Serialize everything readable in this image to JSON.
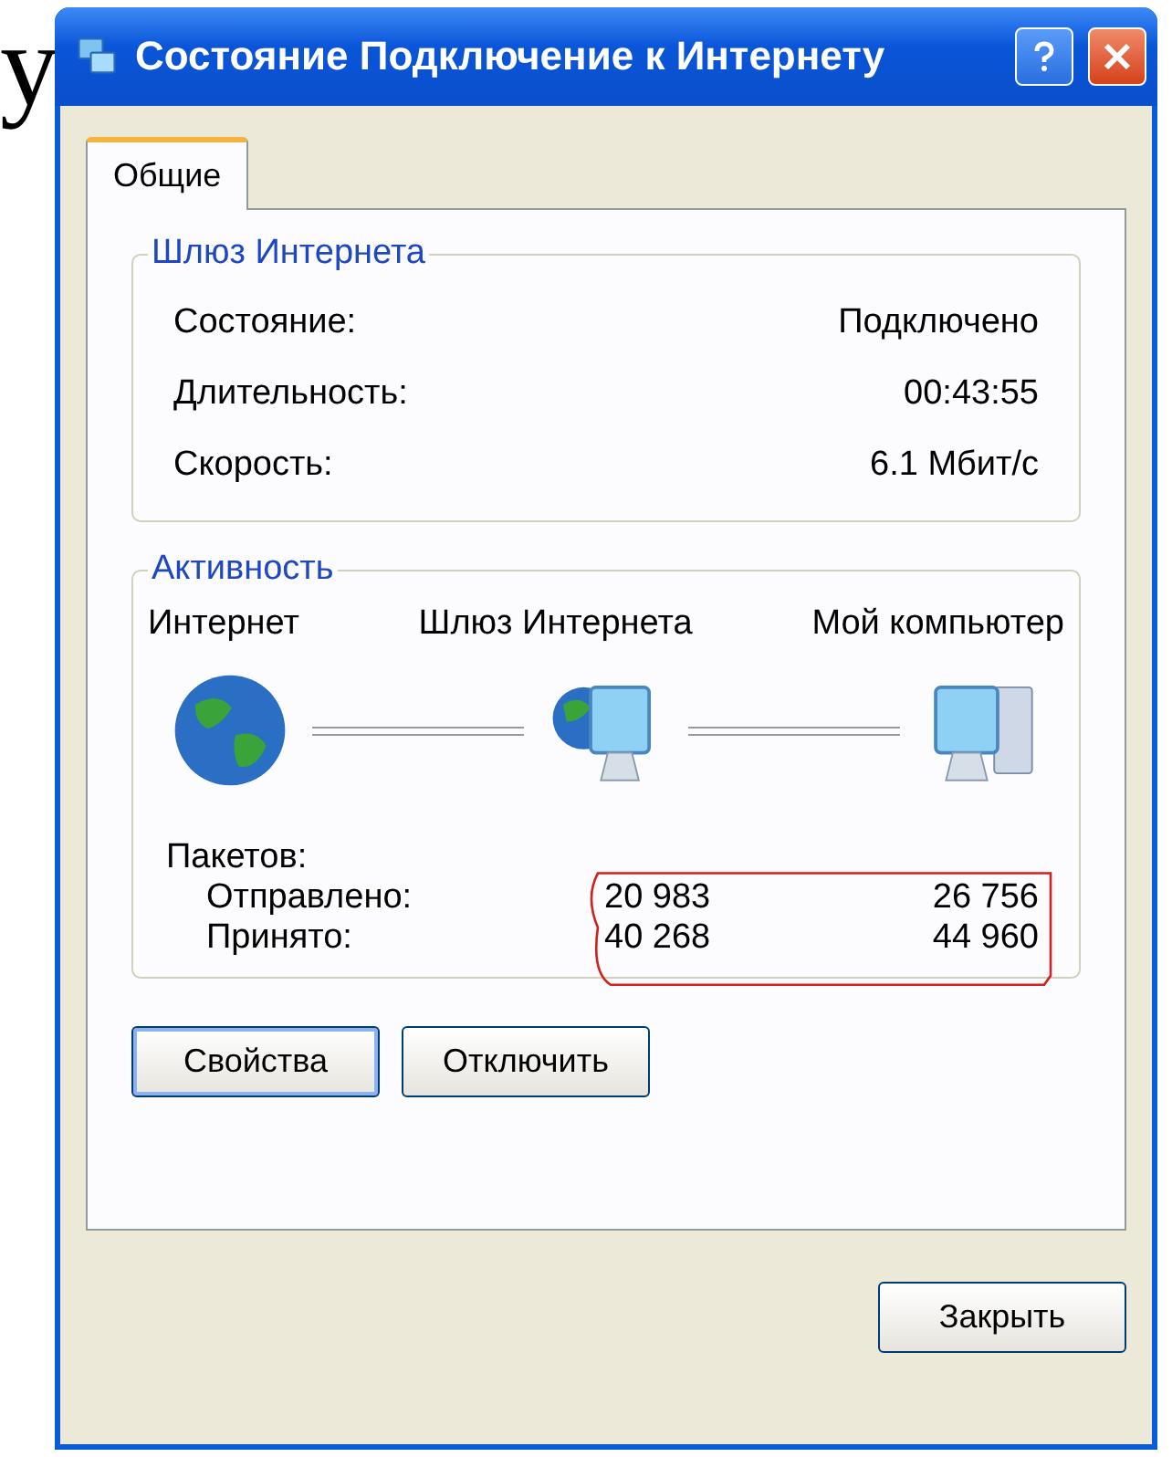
{
  "background_text": "у",
  "window": {
    "title": "Состояние Подключение к Интернету"
  },
  "tabs": [
    {
      "label": "Общие",
      "selected": true
    }
  ],
  "gateway_group": {
    "title": "Шлюз Интернета",
    "rows": [
      {
        "label": "Состояние:",
        "value": "Подключено"
      },
      {
        "label": "Длительность:",
        "value": "00:43:55"
      },
      {
        "label": "Скорость:",
        "value": "6.1 Мбит/с"
      }
    ]
  },
  "activity_group": {
    "title": "Активность",
    "nodes": [
      {
        "label": "Интернет",
        "kind": "globe"
      },
      {
        "label": "Шлюз Интернета",
        "kind": "gateway"
      },
      {
        "label": "Мой компьютер",
        "kind": "computer"
      }
    ],
    "packets_label": "Пакетов:",
    "packet_rows": [
      {
        "label": "Отправлено:",
        "values": [
          "20 983",
          "26 756"
        ]
      },
      {
        "label": "Принято:",
        "values": [
          "40 268",
          "44 960"
        ]
      }
    ]
  },
  "buttons": [
    {
      "label": "Свойства",
      "default": true
    },
    {
      "label": "Отключить",
      "default": false
    }
  ],
  "close_button": "Закрыть"
}
